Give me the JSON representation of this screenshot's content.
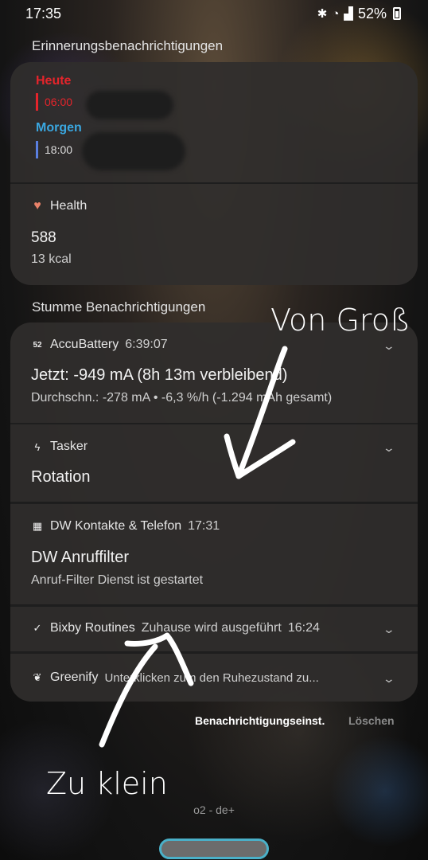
{
  "status_bar": {
    "time": "17:35",
    "battery_text": "52%",
    "icons": [
      "bluetooth-icon",
      "wifi-icon",
      "signal-icon",
      "battery-icon"
    ]
  },
  "reminders": {
    "section_title": "Erinnerungsbenachrichtigungen",
    "today_label": "Heute",
    "today_time": "06:00",
    "tomorrow_label": "Morgen",
    "tomorrow_time": "18:00",
    "colors": {
      "today": "#e5242b",
      "tomorrow": "#3aa7e0",
      "today_bar": "#e5242b",
      "tomorrow_bar": "#5a7fe0"
    }
  },
  "health": {
    "app_name": "Health",
    "value": "588",
    "unit_line": "13 kcal",
    "icon": "heart-pulse-icon",
    "icon_color": "#e8826a"
  },
  "silent": {
    "section_title": "Stumme Benachrichtigungen",
    "accubattery": {
      "icon_text": "52",
      "app_name": "AccuBattery",
      "time": "6:39:07",
      "title": "Jetzt: -949 mA (8h 13m verbleibend)",
      "detail": "Durchschn.: -278 mA • -6,3 %/h (-1.294 mAh gesamt)"
    },
    "tasker": {
      "icon": "lightning-icon",
      "app_name": "Tasker",
      "title": "Rotation"
    },
    "dw": {
      "icon": "grid-icon",
      "app_name": "DW Kontakte & Telefon",
      "time": "17:31",
      "title": "DW Anruffilter",
      "detail": "Anruf-Filter Dienst ist gestartet"
    },
    "bixby": {
      "icon": "check-circle-icon",
      "app_name": "Bixby Routines",
      "text": "Zuhause wird ausgeführt",
      "time": "16:24"
    },
    "greenify": {
      "icon": "leaf-icon",
      "app_name": "Greenify",
      "text": "Unterklicken zum den Ruhezustand zu..."
    }
  },
  "footer": {
    "settings_label": "Benachrichtigungseinst.",
    "clear_label": "Löschen",
    "carrier": "o2 - de+"
  },
  "annotations": {
    "top": "Von Groß",
    "bottom": "Zu klein"
  }
}
